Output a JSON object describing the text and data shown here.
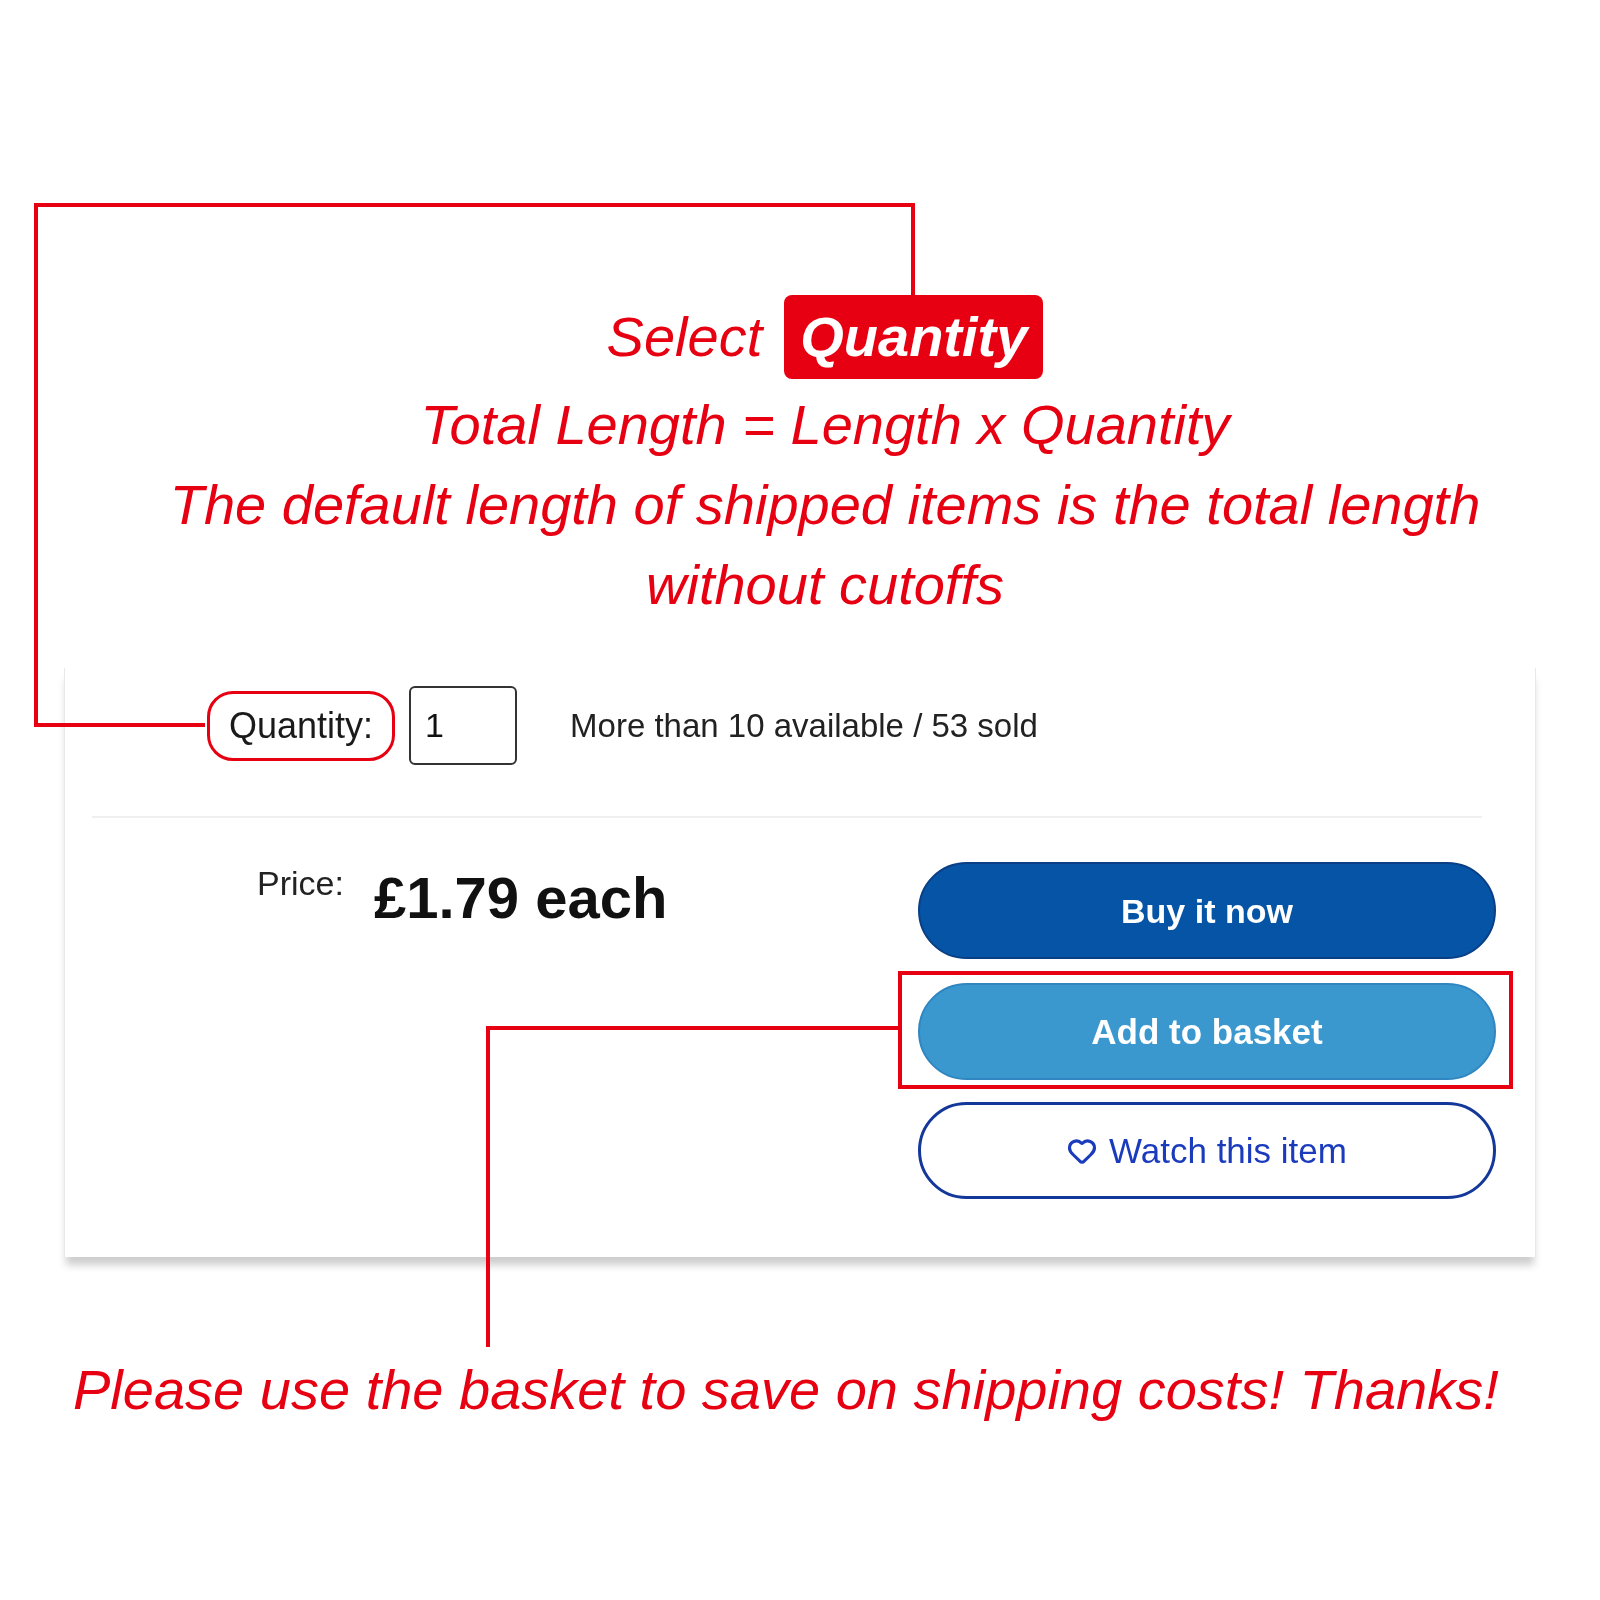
{
  "annotation": {
    "title": "Select",
    "badge": "Quantity",
    "formula": "Total Length = Length x Quantity",
    "note": "The default length of shipped items is the total length without cutoffs"
  },
  "product": {
    "quantity": {
      "label": "Quantity:",
      "value": "1",
      "highlighted": true
    },
    "availability": "More than 10 available / 53 sold",
    "price_label": "Price:",
    "price": "£1.79 each",
    "buttons": [
      {
        "label": "Buy it now",
        "kind": "primary",
        "highlighted": false
      },
      {
        "label": "Add to basket",
        "kind": "secondary",
        "highlighted": true
      },
      {
        "label": "Watch this item",
        "kind": "outline",
        "highlighted": false
      }
    ]
  },
  "footer_note": "Please use the basket to save on shipping costs! Thanks!"
}
